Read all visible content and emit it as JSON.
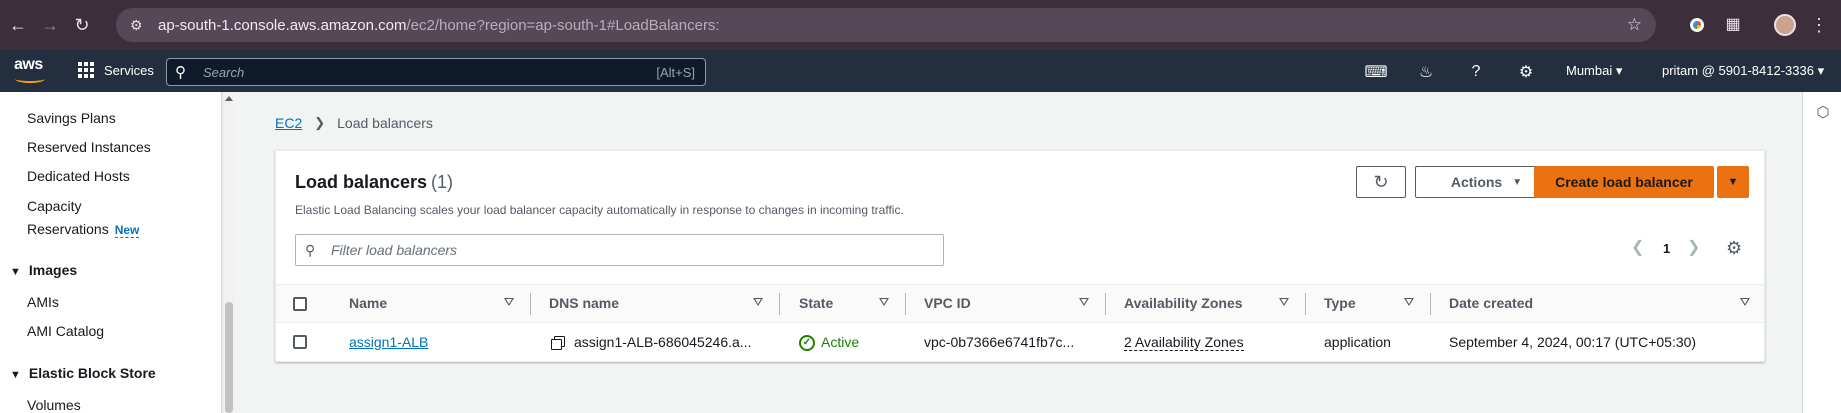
{
  "browser": {
    "url_host": "ap-south-1.console.aws.amazon.com",
    "url_path": "/ec2/home?region=ap-south-1#LoadBalancers:"
  },
  "aws_nav": {
    "logo": "aws",
    "services_label": "Services",
    "search_placeholder": "Search",
    "search_shortcut": "[Alt+S]",
    "region": "Mumbai",
    "account": "pritam @ 5901-8412-3336"
  },
  "sidebar": {
    "items": [
      {
        "label": "Savings Plans"
      },
      {
        "label": "Reserved Instances"
      },
      {
        "label": "Dedicated Hosts"
      },
      {
        "label": "Capacity"
      },
      {
        "label": "Reservations"
      },
      {
        "label": "AMIs"
      },
      {
        "label": "AMI Catalog"
      },
      {
        "label": "Volumes"
      }
    ],
    "new_badge": "New",
    "sections": [
      {
        "label": "Images"
      },
      {
        "label": "Elastic Block Store"
      }
    ]
  },
  "breadcrumb": {
    "root": "EC2",
    "current": "Load balancers"
  },
  "panel": {
    "title": "Load balancers",
    "count": "(1)",
    "description": "Elastic Load Balancing scales your load balancer capacity automatically in response to changes in incoming traffic.",
    "actions_label": "Actions",
    "create_label": "Create load balancer",
    "filter_placeholder": "Filter load balancers",
    "page": "1"
  },
  "table": {
    "columns": [
      "Name",
      "DNS name",
      "State",
      "VPC ID",
      "Availability Zones",
      "Type",
      "Date created"
    ],
    "rows": [
      {
        "name": "assign1-ALB",
        "dns": "assign1-ALB-686045246.a...",
        "state": "Active",
        "vpc": "vpc-0b7366e6741fb7c...",
        "az": "2 Availability Zones",
        "type": "application",
        "created": "September 4, 2024, 00:17 (UTC+05:30)"
      }
    ]
  },
  "colors": {
    "aws_nav_bg": "#232f3e",
    "primary_orange": "#ec7211",
    "link_blue": "#0073bb",
    "status_green": "#1d8102"
  },
  "icons": [
    "back-icon",
    "forward-icon",
    "reload-icon",
    "site-info-icon",
    "star-icon",
    "grid-icon",
    "search-icon",
    "cloudshell-icon",
    "bell-icon",
    "help-icon",
    "gear-icon",
    "refresh-icon",
    "caret-down-icon",
    "copy-icon",
    "check-circle-icon",
    "settings-icon"
  ]
}
